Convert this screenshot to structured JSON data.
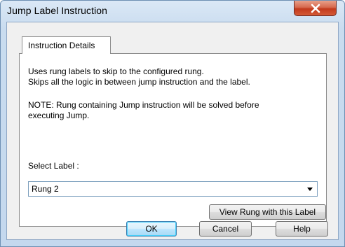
{
  "window": {
    "title": "Jump Label Instruction"
  },
  "tab": {
    "label": "Instruction Details"
  },
  "details": {
    "line1": "Uses rung labels to skip to the configured rung.",
    "line2": "Skips all the logic in between jump instruction and the label.",
    "note_line1": "NOTE: Rung containing Jump instruction will be solved before",
    "note_line2": "executing Jump."
  },
  "label_select": {
    "caption": "Select  Label :",
    "value": "Rung 2"
  },
  "buttons": {
    "view_rung": "View Rung with this Label",
    "ok": "OK",
    "cancel": "Cancel",
    "help": "Help"
  },
  "icons": {
    "close": "close-icon",
    "dropdown": "chevron-down-icon"
  },
  "colors": {
    "close_button": "#c23a1c",
    "default_button_border": "#3c7fb1",
    "window_frame": "#c4d8ee"
  }
}
